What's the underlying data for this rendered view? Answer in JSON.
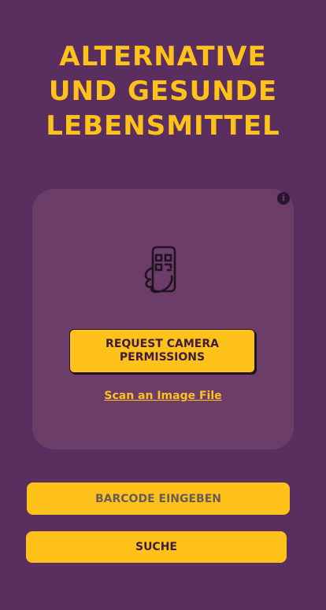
{
  "header": {
    "title_lines": [
      "ALTERNATIVE",
      "UND GESUNDE",
      "LEBENSMITTEL"
    ]
  },
  "scanner": {
    "info_icon": "info-icon",
    "illustration_icon": "phone-qr-scan-icon",
    "request_camera_label": "REQUEST CAMERA PERMISSIONS",
    "scan_file_label": "Scan an Image File"
  },
  "barcode": {
    "placeholder": "BARCODE EINGEBEN",
    "value": ""
  },
  "search": {
    "label": "SUCHE"
  },
  "colors": {
    "background": "#5a2e5e",
    "card": "#6d3d6a",
    "accent": "#ffc21a",
    "dark_text": "#3b1d40"
  }
}
